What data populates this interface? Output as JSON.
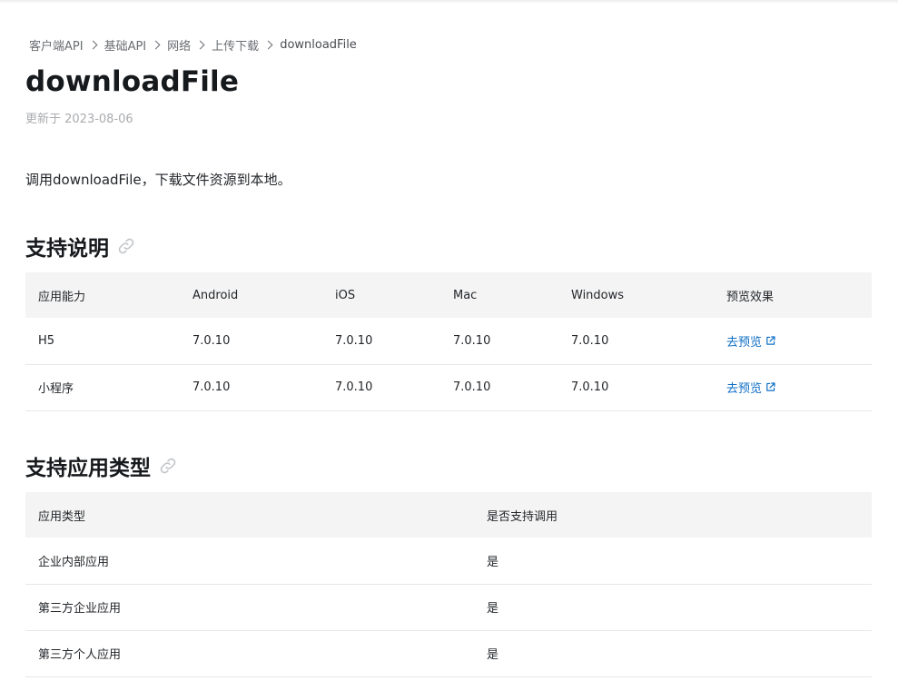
{
  "breadcrumb": {
    "items": [
      "客户端API",
      "基础API",
      "网络",
      "上传下载",
      "downloadFile"
    ]
  },
  "page": {
    "title": "downloadFile",
    "updated": "更新于 2023-08-06",
    "intro": "调用downloadFile，下载文件资源到本地。"
  },
  "support": {
    "heading": "支持说明",
    "columns": [
      "应用能力",
      "Android",
      "iOS",
      "Mac",
      "Windows",
      "预览效果"
    ],
    "rows": [
      [
        "H5",
        "7.0.10",
        "7.0.10",
        "7.0.10",
        "7.0.10",
        "去预览"
      ],
      [
        "小程序",
        "7.0.10",
        "7.0.10",
        "7.0.10",
        "7.0.10",
        "去预览"
      ]
    ]
  },
  "app_types": {
    "heading": "支持应用类型",
    "columns": [
      "应用类型",
      "是否支持调用"
    ],
    "rows": [
      [
        "企业内部应用",
        "是"
      ],
      [
        "第三方企业应用",
        "是"
      ],
      [
        "第三方个人应用",
        "是"
      ]
    ]
  },
  "icons": {
    "anchor": "link-icon",
    "external": "external-link-icon",
    "separator": "chevron-right-icon"
  },
  "colors": {
    "link": "#0f6fc6",
    "header_bg": "#f4f4f4",
    "muted": "#a9abae"
  }
}
